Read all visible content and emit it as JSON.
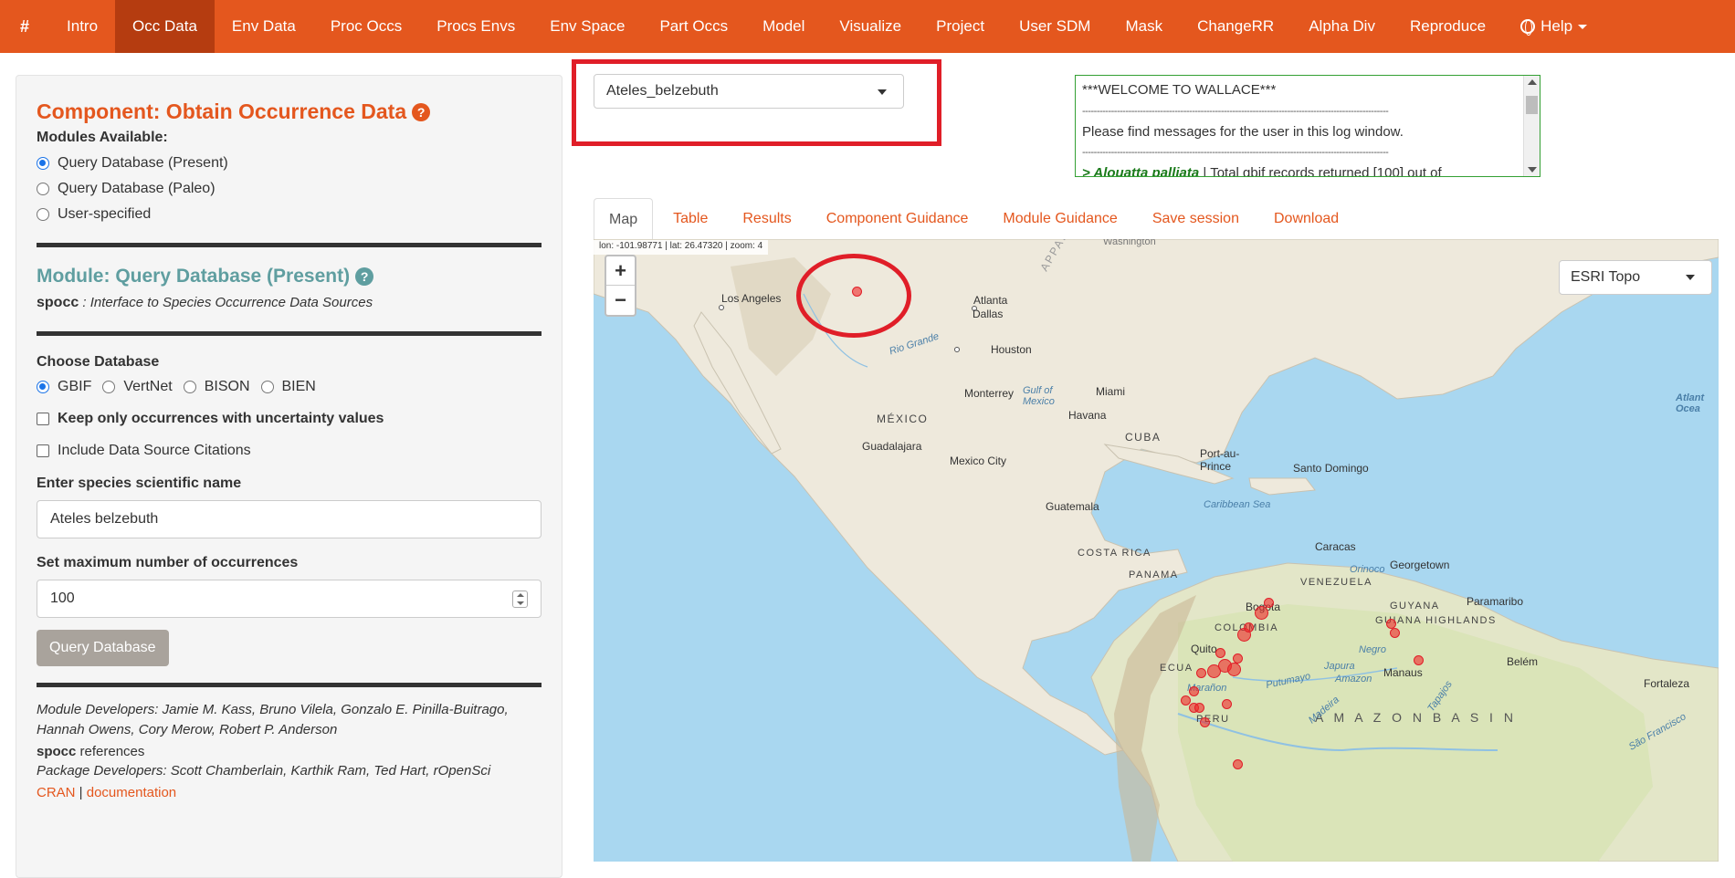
{
  "navbar": {
    "brand": "#",
    "items": [
      "Intro",
      "Occ Data",
      "Env Data",
      "Proc Occs",
      "Procs Envs",
      "Env Space",
      "Part Occs",
      "Model",
      "Visualize",
      "Project",
      "User SDM",
      "Mask",
      "ChangeRR",
      "Alpha Div",
      "Reproduce"
    ],
    "active": "Occ Data",
    "help": "Help"
  },
  "sidebar": {
    "component_title": "Component: Obtain Occurrence Data",
    "modules_label": "Modules Available:",
    "modules": [
      "Query Database (Present)",
      "Query Database (Paleo)",
      "User-specified"
    ],
    "module_selected": "Query Database (Present)",
    "module_title": "Module: Query Database (Present)",
    "pkg_name": "spocc",
    "pkg_desc": " : Interface to Species Occurrence Data Sources",
    "choose_db_label": "Choose Database",
    "databases": [
      "GBIF",
      "VertNet",
      "BISON",
      "BIEN"
    ],
    "db_selected": "GBIF",
    "uncertainty_label": "Keep only occurrences with uncertainty values",
    "citations_label": "Include Data Source Citations",
    "species_label": "Enter species scientific name",
    "species_value": "Ateles belzebuth",
    "max_label": "Set maximum number of occurrences",
    "max_value": "100",
    "query_button": "Query Database",
    "developers": "Module Developers: Jamie M. Kass, Bruno Vilela, Gonzalo E. Pinilla-Buitrago, Hannah Owens, Cory Merow, Robert P. Anderson",
    "refs_pkg": "spocc",
    "refs_text": " references",
    "pkg_developers": "Package Developers: Scott Chamberlain, Karthik Ram, Ted Hart, rOpenSci",
    "link_cran": "CRAN",
    "link_sep": " | ",
    "link_doc": "documentation"
  },
  "species_select": {
    "value": "Ateles_belzebuth"
  },
  "log": {
    "welcome": "***WELCOME TO WALLACE***",
    "dash": "----------------------------------------------------------------------------------------------------------",
    "message": "Please find messages for the user in this log window.",
    "entry_species": "> Alouatta palliata",
    "entry_sep": " | ",
    "entry_text": "Total gbif records returned [100] out of"
  },
  "tabs": [
    "Map",
    "Table",
    "Results",
    "Component Guidance",
    "Module Guidance",
    "Save session",
    "Download"
  ],
  "tab_active": "Map",
  "map": {
    "coords": "lon: -101.98771 | lat: 26.47320 | zoom: 4",
    "zoom_in": "+",
    "zoom_out": "−",
    "basemap": "ESRI Topo",
    "labels": {
      "washington": "Washington",
      "los_angeles": "Los Angeles",
      "dallas": "Dallas",
      "atlanta": "Atlanta",
      "houston": "Houston",
      "rio_grande": "Rio Grande",
      "monterrey": "Monterrey",
      "miami": "Miami",
      "gulf": "Gulf of\nMexico",
      "mexico": "MÉXICO",
      "havana": "Havana",
      "cuba": "CUBA",
      "guadalajara": "Guadalajara",
      "mexico_city": "Mexico City",
      "port_au_prince": "Port-au-\nPrince",
      "santo_domingo": "Santo Domingo",
      "caribbean": "Caribbean Sea",
      "guatemala": "Guatemala",
      "costa_rica": "COSTA RICA",
      "panama": "PANAMA",
      "caracas": "Caracas",
      "orinoco": "Orinoco",
      "georgetown": "Georgetown",
      "venezuela": "VENEZUELA",
      "guyana": "GUYANA",
      "paramaribo": "Paramaribo",
      "bogota": "Bogota",
      "colombia": "COLOMBIA",
      "guiana_highlands": "GUIANA HIGHLANDS",
      "quito": "Quito",
      "ecuador": "ECUA",
      "negro": "Negro",
      "japura": "Japura",
      "putumayo": "Putumayo",
      "amazon": "Amazon",
      "manaus": "Manaus",
      "belem": "Belém",
      "fortaleza": "Fortaleza",
      "maranon": "Marañon",
      "peru": "PERU",
      "amazon_basin": "A M A Z O N   B A S I N",
      "madeira": "Madeira",
      "tapajos": "Tapajos",
      "sao_francisco": "São Francisco",
      "atlantic": "Atlant\nOcea",
      "appalachian": "APPALA"
    }
  },
  "colors": {
    "brand": "#e4571e",
    "brand_dark": "#b53c10",
    "module_teal": "#5f9ea0",
    "annotation_red": "#e01e28",
    "log_border": "#33a033"
  }
}
